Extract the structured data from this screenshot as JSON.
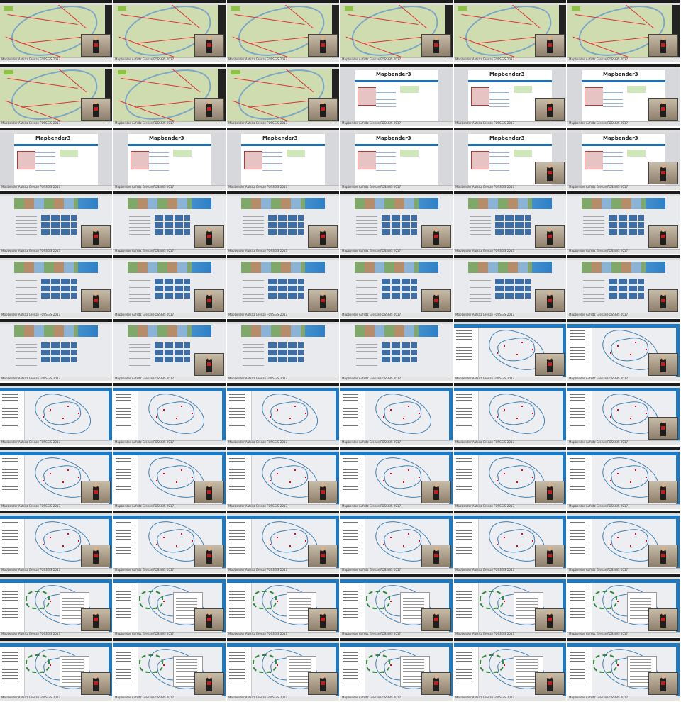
{
  "window": {
    "caption": "Mapbender Aufsitz Grenze FOSSGIS 2017"
  },
  "layout": {
    "columns": 6,
    "rows": 11
  },
  "tiles": [
    {
      "scene": "topo",
      "cam": true
    },
    {
      "scene": "topo",
      "cam": true
    },
    {
      "scene": "topo",
      "cam": true
    },
    {
      "scene": "topo",
      "cam": true
    },
    {
      "scene": "topo",
      "cam": true
    },
    {
      "scene": "topo",
      "cam": true
    },
    {
      "scene": "topo",
      "cam": true
    },
    {
      "scene": "topo",
      "cam": true
    },
    {
      "scene": "topo",
      "cam": true
    },
    {
      "scene": "mapbender",
      "cam": false
    },
    {
      "scene": "mapbender",
      "cam": true
    },
    {
      "scene": "mapbender",
      "cam": true
    },
    {
      "scene": "mapbender",
      "cam": false
    },
    {
      "scene": "mapbender",
      "cam": false
    },
    {
      "scene": "mapbender",
      "cam": false
    },
    {
      "scene": "mapbender",
      "cam": false
    },
    {
      "scene": "mapbender",
      "cam": true
    },
    {
      "scene": "mapbender",
      "cam": true
    },
    {
      "scene": "osgeo",
      "cam": true
    },
    {
      "scene": "osgeo",
      "cam": true
    },
    {
      "scene": "osgeo",
      "cam": true
    },
    {
      "scene": "osgeo",
      "cam": true
    },
    {
      "scene": "osgeo",
      "cam": true
    },
    {
      "scene": "osgeo",
      "cam": true
    },
    {
      "scene": "osgeo",
      "cam": true
    },
    {
      "scene": "osgeo",
      "cam": true
    },
    {
      "scene": "osgeo",
      "cam": true
    },
    {
      "scene": "osgeo",
      "cam": true
    },
    {
      "scene": "osgeo",
      "cam": true
    },
    {
      "scene": "osgeo",
      "cam": true
    },
    {
      "scene": "osgeo",
      "cam": false
    },
    {
      "scene": "osgeo",
      "cam": true
    },
    {
      "scene": "osgeo",
      "cam": false
    },
    {
      "scene": "osgeo",
      "cam": false
    },
    {
      "scene": "vector",
      "cam": true
    },
    {
      "scene": "vector",
      "cam": true
    },
    {
      "scene": "vector",
      "cam": false
    },
    {
      "scene": "vector",
      "cam": false
    },
    {
      "scene": "vector",
      "cam": false
    },
    {
      "scene": "vector",
      "cam": false
    },
    {
      "scene": "vector",
      "cam": false
    },
    {
      "scene": "vector",
      "cam": true
    },
    {
      "scene": "vector",
      "cam": true
    },
    {
      "scene": "vector",
      "cam": true
    },
    {
      "scene": "vector",
      "cam": true
    },
    {
      "scene": "vector",
      "cam": true
    },
    {
      "scene": "vector",
      "cam": true
    },
    {
      "scene": "vector",
      "cam": true
    },
    {
      "scene": "vector",
      "cam": true
    },
    {
      "scene": "vector",
      "cam": true
    },
    {
      "scene": "vector",
      "cam": true
    },
    {
      "scene": "vector",
      "cam": true
    },
    {
      "scene": "vector",
      "cam": true
    },
    {
      "scene": "vector",
      "cam": true
    },
    {
      "scene": "vector-green",
      "cam": true
    },
    {
      "scene": "vector-green",
      "cam": true
    },
    {
      "scene": "vector-green",
      "cam": true
    },
    {
      "scene": "vector-green",
      "cam": true
    },
    {
      "scene": "vector-green",
      "cam": true
    },
    {
      "scene": "vector-green",
      "cam": true
    },
    {
      "scene": "vector-green",
      "cam": true
    },
    {
      "scene": "vector-green",
      "cam": true
    },
    {
      "scene": "vector-green",
      "cam": true
    },
    {
      "scene": "vector-green",
      "cam": true
    },
    {
      "scene": "vector-green",
      "cam": true
    },
    {
      "scene": "vector-green",
      "cam": true
    }
  ],
  "mapbender": {
    "brand": "Mapbender3"
  },
  "icons": {
    "webcam": "webcam-overlay-icon",
    "logo": "mapbender-logo-icon"
  }
}
